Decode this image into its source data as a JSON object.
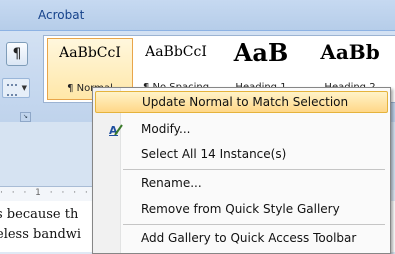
{
  "ribbon": {
    "tab_label": "Acrobat",
    "paragraph_mark": "¶",
    "launcher_glyph": "↘"
  },
  "gallery": {
    "styles": [
      {
        "preview": "AaBbCcI",
        "caption": "¶ Normal"
      },
      {
        "preview": "AaBbCcI",
        "caption": "¶ No Spacing"
      },
      {
        "preview": "AaB",
        "caption": "Heading 1"
      },
      {
        "preview": "AaBb",
        "caption": "Heading 2"
      }
    ]
  },
  "context_menu": {
    "items": [
      {
        "label": "Update Normal to Match Selection",
        "highlighted": true
      },
      {
        "label": "Modify..."
      },
      {
        "label": "Select All 14 Instance(s)"
      },
      {
        "label": "Rename..."
      },
      {
        "label": "Remove from Quick Style Gallery"
      },
      {
        "label": "Add Gallery to Quick Access Toolbar"
      }
    ]
  },
  "document": {
    "ruler_text": "·  ·  ·  1  ·  ·  ·  ·",
    "lines": [
      "s because th",
      "eless bandwi"
    ]
  },
  "colors": {
    "highlight": "#ffd788",
    "ribbon_text": "#15428b"
  }
}
